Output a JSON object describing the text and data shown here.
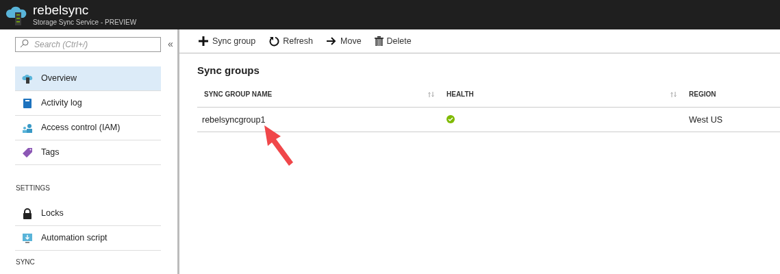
{
  "header": {
    "title": "rebelsync",
    "subtitle": "Storage Sync Service - PREVIEW"
  },
  "sidebar": {
    "search": {
      "placeholder": "Search (Ctrl+/)"
    },
    "collapse": "«",
    "sections": [
      {
        "items": [
          {
            "label": "Overview",
            "kind": "cloud",
            "selected": true
          },
          {
            "label": "Activity log",
            "kind": "book",
            "selected": false
          },
          {
            "label": "Access control (IAM)",
            "kind": "people",
            "selected": false
          },
          {
            "label": "Tags",
            "kind": "tag",
            "selected": false
          }
        ]
      },
      {
        "title": "SETTINGS",
        "items": [
          {
            "label": "Locks",
            "kind": "lock",
            "selected": false
          },
          {
            "label": "Automation script",
            "kind": "monitor",
            "selected": false
          }
        ]
      },
      {
        "title": "SYNC"
      }
    ]
  },
  "toolbar": [
    {
      "label": "Sync group",
      "kind": "plus"
    },
    {
      "label": "Refresh",
      "kind": "refresh"
    },
    {
      "label": "Move",
      "kind": "arrow"
    },
    {
      "label": "Delete",
      "kind": "trash"
    }
  ],
  "content": {
    "title": "Sync groups",
    "table": {
      "columns": [
        {
          "label": "SYNC GROUP NAME",
          "sortable": true
        },
        {
          "label": "HEALTH",
          "sortable": true
        },
        {
          "label": "REGION",
          "sortable": false
        }
      ],
      "rows": [
        {
          "name": "rebelsyncgroup1",
          "healthy": true,
          "region": "West US"
        }
      ]
    }
  }
}
